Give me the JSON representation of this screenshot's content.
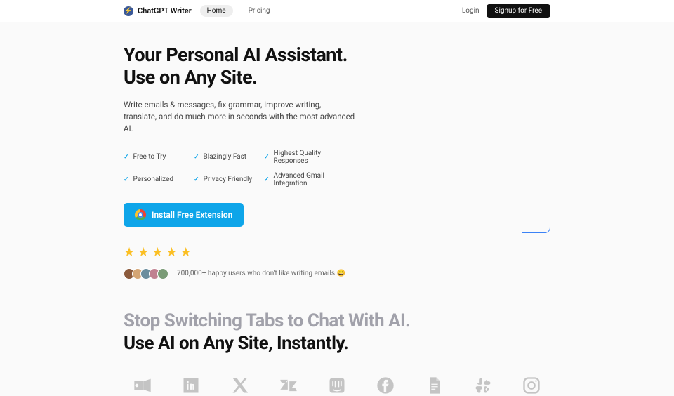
{
  "header": {
    "brand": "ChatGPT Writer",
    "nav": {
      "home": "Home",
      "pricing": "Pricing"
    },
    "login": "Login",
    "signup": "Signup for Free"
  },
  "hero": {
    "title_line1": "Your Personal AI Assistant.",
    "title_line2": "Use on Any Site.",
    "subtitle": "Write emails & messages, fix grammar, improve writing, translate, and do much more in seconds with the most advanced AI.",
    "features": [
      "Free to Try",
      "Blazingly Fast",
      "Highest Quality Responses",
      "Personalized",
      "Privacy Friendly",
      "Advanced Gmail Integration"
    ],
    "cta": "Install Free Extension",
    "social_proof": "700,000+ happy users who don't like writing emails 😀"
  },
  "section2": {
    "line1": "Stop Switching Tabs to Chat With AI.",
    "line2": "Use AI on Any Site, Instantly."
  }
}
